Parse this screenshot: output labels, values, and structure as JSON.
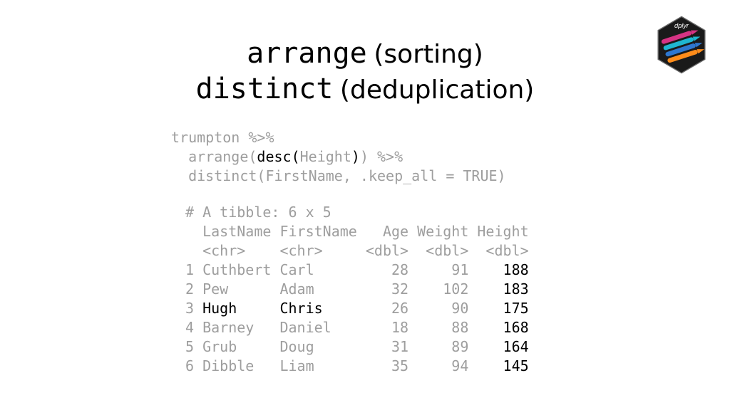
{
  "title": {
    "line1_mono": "arrange",
    "line1_sans": "(sorting)",
    "line2_mono": "distinct",
    "line2_sans": "(deduplication)"
  },
  "code": {
    "l1a": "trumpton %>%",
    "l2a": "  arrange(",
    "l2b": "desc(",
    "l2c": "Height",
    "l2d": ")",
    "l2e": ") %>%",
    "l3a": "  distinct(FirstName, .keep_all = TRUE)"
  },
  "output": {
    "hdr1": "# A tibble: 6 x 5",
    "hdr2": "  LastName FirstName   Age Weight Height",
    "hdr3": "  <chr>    <chr>     <dbl>  <dbl>  <dbl>",
    "r1a": "1 Cuthbert Carl         28     91    ",
    "r1b": "188",
    "r2a": "2 Pew      Adam         32    102    ",
    "r2b": "183",
    "r3a": "3 ",
    "r3b": "Hugh     Chris",
    "r3c": "        26     90    ",
    "r3d": "175",
    "r4a": "4 Barney   Daniel       18     88    ",
    "r4b": "168",
    "r5a": "5 Grub     Doug         31     89    ",
    "r5b": "164",
    "r6a": "6 Dibble   Liam         35     94    ",
    "r6b": "145"
  },
  "logo": {
    "label": "dplyr"
  }
}
